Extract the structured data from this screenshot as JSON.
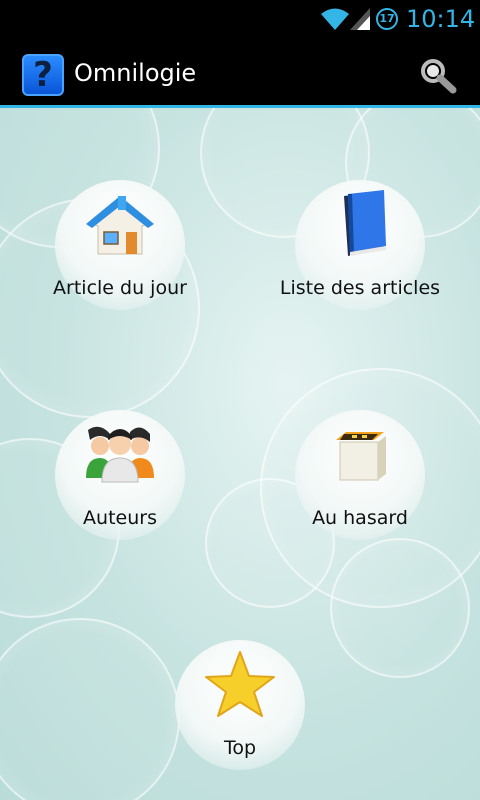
{
  "status_bar": {
    "time": "10:14",
    "notification_count": "17",
    "wifi_icon": "wifi-icon",
    "signal_icon": "signal-icon",
    "accent_color": "#33b5e5"
  },
  "action_bar": {
    "app_icon_glyph": "?",
    "title": "Omnilogie",
    "search_icon": "search-icon"
  },
  "menu": {
    "items": [
      {
        "label": "Article du jour",
        "icon": "house-icon"
      },
      {
        "label": "Liste des articles",
        "icon": "book-icon"
      },
      {
        "label": "Auteurs",
        "icon": "people-icon"
      },
      {
        "label": "Au hasard",
        "icon": "box-icon"
      },
      {
        "label": "Top",
        "icon": "star-icon"
      }
    ]
  }
}
